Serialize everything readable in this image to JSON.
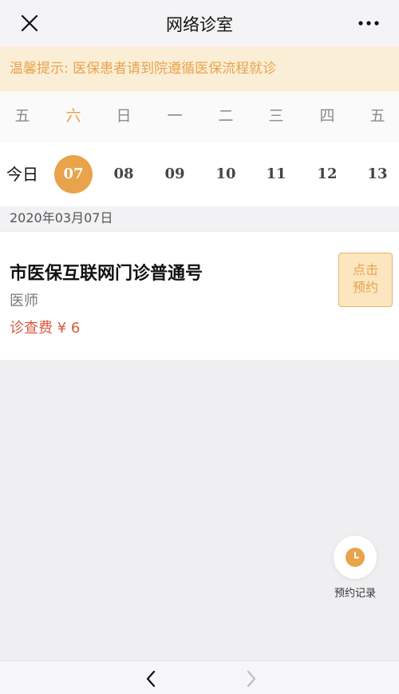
{
  "navbar": {
    "title": "网络诊室"
  },
  "notice": {
    "text": "温馨提示: 医保患者请到院遵循医保流程就诊"
  },
  "week": {
    "days": [
      "五",
      "六",
      "日",
      "一",
      "二",
      "三",
      "四",
      "五"
    ]
  },
  "dates": {
    "today_label": "今日",
    "days": [
      "07",
      "08",
      "09",
      "10",
      "11",
      "12",
      "13"
    ],
    "selected_index": 0
  },
  "selected_date": "2020年03月07日",
  "clinic": {
    "title": "市医保互联网门诊普通号",
    "role": "医师",
    "fee": "诊查费 ¥ 6",
    "book_line1": "点击",
    "book_line2": "预约"
  },
  "records": {
    "label": "预约记录"
  },
  "colors": {
    "accent": "#e8a34b",
    "fee": "#d9573e",
    "notice_bg": "#fbeed7"
  },
  "icons": {
    "close": "close-icon",
    "more": "more-icon",
    "clock": "clock-icon",
    "back": "chevron-left-icon",
    "forward": "chevron-right-icon"
  }
}
